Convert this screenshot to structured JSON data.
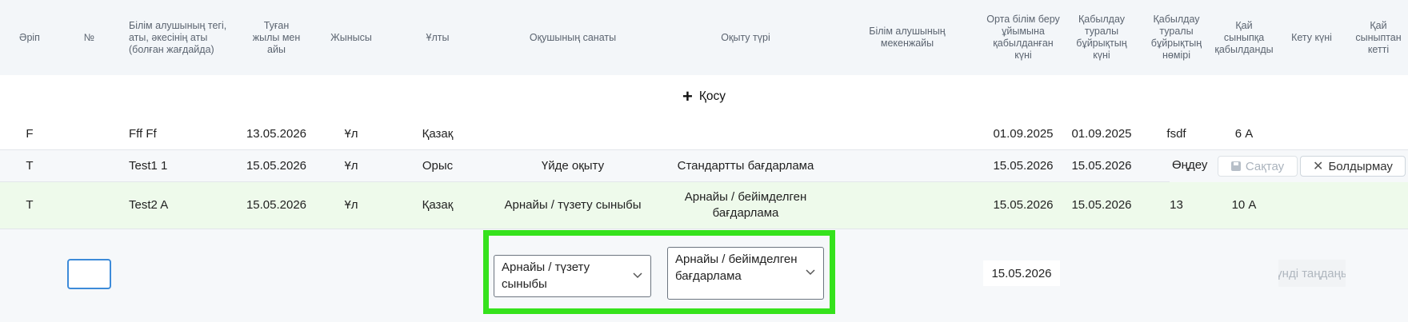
{
  "columns": [
    "Әріп",
    "№",
    "Білім алушының тегі, аты, әкесінің аты (болған жағдайда)",
    "Туған жылы мен айы",
    "Жынысы",
    "Ұлты",
    "Оқушының санаты",
    "Оқыту түрі",
    "Білім алушының мекенжайы",
    "Орта білім беру ұйымына қабылданған күні",
    "Қабылдау туралы бұйрықтың күні",
    "Қабылдау туралы бұйрықтың нөмірі",
    "Қай сыныпқа қабылданды",
    "Кету күні",
    "Қай сыныптан кетті"
  ],
  "add_label": "Қосу",
  "rows": [
    {
      "letter": "F",
      "num": "",
      "name": "Fff Ff",
      "birth": "13.05.2026",
      "gender": "Ұл",
      "nation": "Қазақ",
      "category": "",
      "training": "",
      "address": "",
      "admit_date": "01.09.2025",
      "order_date": "01.09.2025",
      "order_num": "fsdf",
      "class": "6 А",
      "leave_date": "",
      "leave_class": ""
    },
    {
      "letter": "Т",
      "num": "",
      "name": "Test1 1",
      "birth": "15.05.2026",
      "gender": "Ұл",
      "nation": "Орыс",
      "category": "Үйде оқыту",
      "training": "Стандартты бағдарлама",
      "address": "",
      "admit_date": "15.05.2026",
      "order_date": "15.05.2026",
      "order_num": "",
      "class": "",
      "leave_date": "",
      "leave_class": ""
    },
    {
      "letter": "Т",
      "num": "",
      "name": "Test2 A",
      "birth": "15.05.2026",
      "gender": "Ұл",
      "nation": "Қазақ",
      "category": "Арнайы / түзету сыныбы",
      "training": "Арнайы / бейімделген бағдарлама",
      "address": "",
      "admit_date": "15.05.2026",
      "order_date": "15.05.2026",
      "order_num": "13",
      "class": "10 А",
      "leave_date": "",
      "leave_class": ""
    }
  ],
  "row_actions": {
    "edit": "Өңдеу",
    "save": "Сақтау",
    "cancel": "Болдырмау"
  },
  "edit_row": {
    "number_value": "",
    "category_value": "Арнайы / түзету сыныбы",
    "training_value": "Арнайы / бейімделген бағдарлама",
    "admit_date": "15.05.2026",
    "pick_date_placeholder": "Күнді таңдаңыз"
  },
  "colors": {
    "header_bg": "#f3f6f9",
    "hover_row": "#eefaeb",
    "highlight": "#35e21c",
    "input_focus": "#3d8bd9"
  }
}
